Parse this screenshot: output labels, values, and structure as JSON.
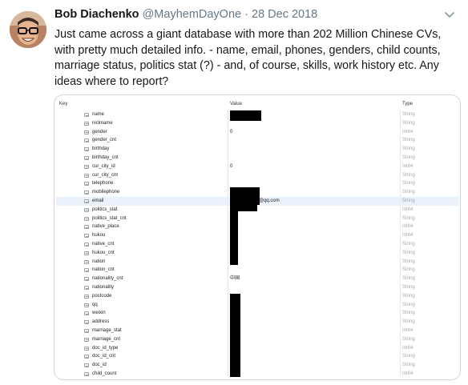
{
  "tweet": {
    "author_name": "Bob Diachenko",
    "handle": "@MayhemDayOne",
    "separator": "·",
    "date": "28 Dec 2018",
    "text": "Just came across a giant database with more than 202 Million Chinese CVs, with pretty much detailed info. - name, email, phones, genders, child counts, marriage status, politics stat (?) - and, of course, skills, work history etc. Any ideas where to report?"
  },
  "db_view": {
    "columns": {
      "key": "Key",
      "value": "Value",
      "type": "Type"
    },
    "rows": [
      {
        "key": "name",
        "value": "",
        "type": "String"
      },
      {
        "key": "nickname",
        "value": "",
        "type": "String"
      },
      {
        "key": "gender",
        "value": "0",
        "type": "Int64"
      },
      {
        "key": "gender_cnt",
        "value": "",
        "type": "String"
      },
      {
        "key": "birthday",
        "value": "",
        "type": "String"
      },
      {
        "key": "birthday_cnt",
        "value": "",
        "type": "String"
      },
      {
        "key": "cur_city_id",
        "value": "0",
        "type": "Int64"
      },
      {
        "key": "cur_city_cnt",
        "value": "",
        "type": "String"
      },
      {
        "key": "telephone",
        "value": "",
        "type": "String"
      },
      {
        "key": "mobilephone",
        "value": "",
        "type": "String"
      },
      {
        "key": "email",
        "value": "@qq.com",
        "type": "String"
      },
      {
        "key": "politics_stat",
        "value": "",
        "type": "Int64"
      },
      {
        "key": "politics_stat_cnt",
        "value": "",
        "type": "String"
      },
      {
        "key": "native_place",
        "value": "",
        "type": "Int64"
      },
      {
        "key": "hukou",
        "value": "",
        "type": "Int64"
      },
      {
        "key": "native_cnt",
        "value": "",
        "type": "String"
      },
      {
        "key": "hukou_cnt",
        "value": "",
        "type": "String"
      },
      {
        "key": "nation",
        "value": "",
        "type": "String"
      },
      {
        "key": "nation_cnt",
        "value": "",
        "type": "String"
      },
      {
        "key": "nationality_cnt",
        "value": "中国",
        "type": "String"
      },
      {
        "key": "nationality",
        "value": "",
        "type": "String"
      },
      {
        "key": "postcode",
        "value": "",
        "type": "String"
      },
      {
        "key": "qq",
        "value": "",
        "type": "String"
      },
      {
        "key": "weixin",
        "value": "",
        "type": "String"
      },
      {
        "key": "address",
        "value": "",
        "type": "String"
      },
      {
        "key": "marriage_stat",
        "value": "",
        "type": "Int64"
      },
      {
        "key": "marriage_cnt",
        "value": "",
        "type": "String"
      },
      {
        "key": "doc_id_type",
        "value": "",
        "type": "Int64"
      },
      {
        "key": "doc_id_cnt",
        "value": "",
        "type": "String"
      },
      {
        "key": "doc_id",
        "value": "",
        "type": "String"
      },
      {
        "key": "child_count",
        "value": "",
        "type": "Int64"
      }
    ]
  },
  "icons": {
    "avatar": "avatar",
    "menu": "chevron-down-icon",
    "field": "field-icon"
  },
  "colors": {
    "name": "#14171a",
    "muted": "#657786",
    "selected_row": "#e9f1fb",
    "type_text": "#a8a8a8"
  }
}
